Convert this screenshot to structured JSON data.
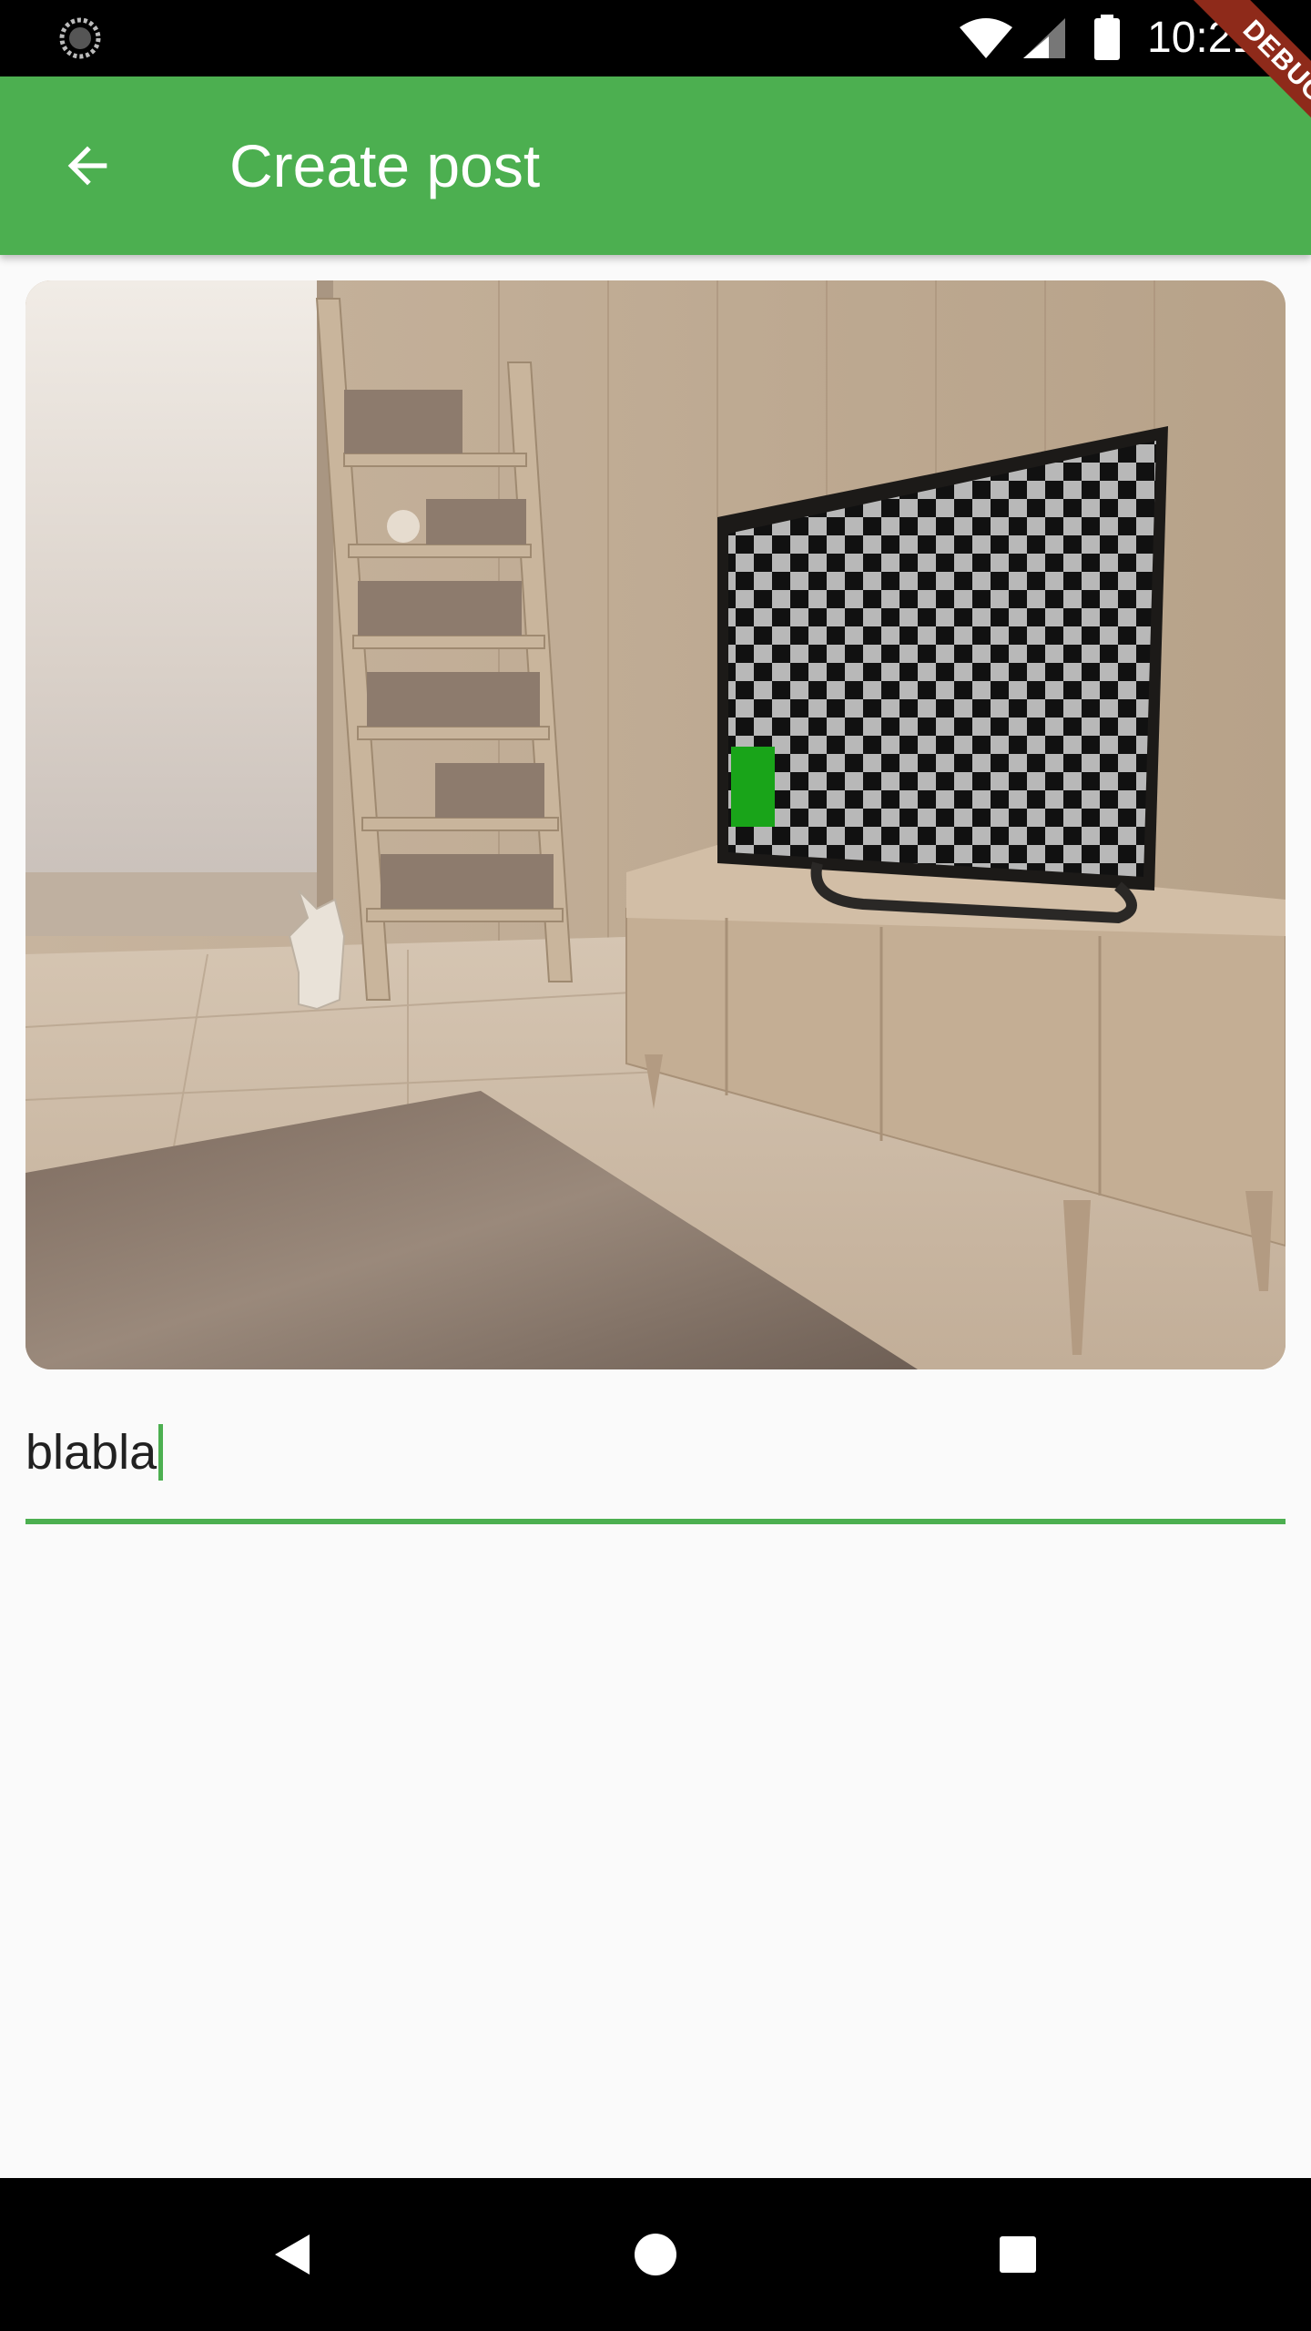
{
  "status_bar": {
    "time": "10:21"
  },
  "debug_banner": {
    "label": "DEBUG"
  },
  "app_bar": {
    "title": "Create post",
    "back_icon": "arrow-back-icon",
    "color": "#4caf50"
  },
  "post": {
    "image_description_icon": "room-photo",
    "caption_value": "blabla",
    "caption_placeholder": ""
  },
  "nav_bar": {
    "icons": [
      "back-triangle-icon",
      "home-circle-icon",
      "recents-square-icon"
    ]
  }
}
